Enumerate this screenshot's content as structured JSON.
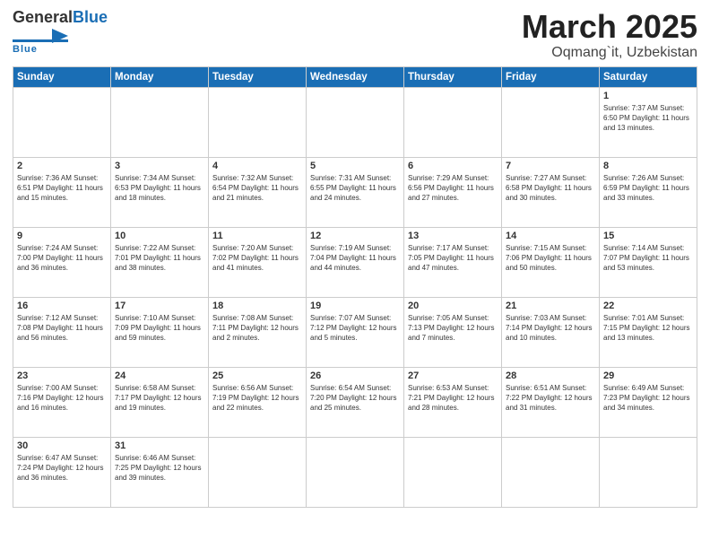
{
  "logo": {
    "general": "General",
    "blue": "Blue",
    "tagline": "Blue"
  },
  "title": "March 2025",
  "subtitle": "Oqmang`it, Uzbekistan",
  "days_of_week": [
    "Sunday",
    "Monday",
    "Tuesday",
    "Wednesday",
    "Thursday",
    "Friday",
    "Saturday"
  ],
  "weeks": [
    [
      {
        "num": "",
        "info": ""
      },
      {
        "num": "",
        "info": ""
      },
      {
        "num": "",
        "info": ""
      },
      {
        "num": "",
        "info": ""
      },
      {
        "num": "",
        "info": ""
      },
      {
        "num": "",
        "info": ""
      },
      {
        "num": "1",
        "info": "Sunrise: 7:37 AM\nSunset: 6:50 PM\nDaylight: 11 hours and 13 minutes."
      }
    ],
    [
      {
        "num": "2",
        "info": "Sunrise: 7:36 AM\nSunset: 6:51 PM\nDaylight: 11 hours and 15 minutes."
      },
      {
        "num": "3",
        "info": "Sunrise: 7:34 AM\nSunset: 6:53 PM\nDaylight: 11 hours and 18 minutes."
      },
      {
        "num": "4",
        "info": "Sunrise: 7:32 AM\nSunset: 6:54 PM\nDaylight: 11 hours and 21 minutes."
      },
      {
        "num": "5",
        "info": "Sunrise: 7:31 AM\nSunset: 6:55 PM\nDaylight: 11 hours and 24 minutes."
      },
      {
        "num": "6",
        "info": "Sunrise: 7:29 AM\nSunset: 6:56 PM\nDaylight: 11 hours and 27 minutes."
      },
      {
        "num": "7",
        "info": "Sunrise: 7:27 AM\nSunset: 6:58 PM\nDaylight: 11 hours and 30 minutes."
      },
      {
        "num": "8",
        "info": "Sunrise: 7:26 AM\nSunset: 6:59 PM\nDaylight: 11 hours and 33 minutes."
      }
    ],
    [
      {
        "num": "9",
        "info": "Sunrise: 7:24 AM\nSunset: 7:00 PM\nDaylight: 11 hours and 36 minutes."
      },
      {
        "num": "10",
        "info": "Sunrise: 7:22 AM\nSunset: 7:01 PM\nDaylight: 11 hours and 38 minutes."
      },
      {
        "num": "11",
        "info": "Sunrise: 7:20 AM\nSunset: 7:02 PM\nDaylight: 11 hours and 41 minutes."
      },
      {
        "num": "12",
        "info": "Sunrise: 7:19 AM\nSunset: 7:04 PM\nDaylight: 11 hours and 44 minutes."
      },
      {
        "num": "13",
        "info": "Sunrise: 7:17 AM\nSunset: 7:05 PM\nDaylight: 11 hours and 47 minutes."
      },
      {
        "num": "14",
        "info": "Sunrise: 7:15 AM\nSunset: 7:06 PM\nDaylight: 11 hours and 50 minutes."
      },
      {
        "num": "15",
        "info": "Sunrise: 7:14 AM\nSunset: 7:07 PM\nDaylight: 11 hours and 53 minutes."
      }
    ],
    [
      {
        "num": "16",
        "info": "Sunrise: 7:12 AM\nSunset: 7:08 PM\nDaylight: 11 hours and 56 minutes."
      },
      {
        "num": "17",
        "info": "Sunrise: 7:10 AM\nSunset: 7:09 PM\nDaylight: 11 hours and 59 minutes."
      },
      {
        "num": "18",
        "info": "Sunrise: 7:08 AM\nSunset: 7:11 PM\nDaylight: 12 hours and 2 minutes."
      },
      {
        "num": "19",
        "info": "Sunrise: 7:07 AM\nSunset: 7:12 PM\nDaylight: 12 hours and 5 minutes."
      },
      {
        "num": "20",
        "info": "Sunrise: 7:05 AM\nSunset: 7:13 PM\nDaylight: 12 hours and 7 minutes."
      },
      {
        "num": "21",
        "info": "Sunrise: 7:03 AM\nSunset: 7:14 PM\nDaylight: 12 hours and 10 minutes."
      },
      {
        "num": "22",
        "info": "Sunrise: 7:01 AM\nSunset: 7:15 PM\nDaylight: 12 hours and 13 minutes."
      }
    ],
    [
      {
        "num": "23",
        "info": "Sunrise: 7:00 AM\nSunset: 7:16 PM\nDaylight: 12 hours and 16 minutes."
      },
      {
        "num": "24",
        "info": "Sunrise: 6:58 AM\nSunset: 7:17 PM\nDaylight: 12 hours and 19 minutes."
      },
      {
        "num": "25",
        "info": "Sunrise: 6:56 AM\nSunset: 7:19 PM\nDaylight: 12 hours and 22 minutes."
      },
      {
        "num": "26",
        "info": "Sunrise: 6:54 AM\nSunset: 7:20 PM\nDaylight: 12 hours and 25 minutes."
      },
      {
        "num": "27",
        "info": "Sunrise: 6:53 AM\nSunset: 7:21 PM\nDaylight: 12 hours and 28 minutes."
      },
      {
        "num": "28",
        "info": "Sunrise: 6:51 AM\nSunset: 7:22 PM\nDaylight: 12 hours and 31 minutes."
      },
      {
        "num": "29",
        "info": "Sunrise: 6:49 AM\nSunset: 7:23 PM\nDaylight: 12 hours and 34 minutes."
      }
    ],
    [
      {
        "num": "30",
        "info": "Sunrise: 6:47 AM\nSunset: 7:24 PM\nDaylight: 12 hours and 36 minutes."
      },
      {
        "num": "31",
        "info": "Sunrise: 6:46 AM\nSunset: 7:25 PM\nDaylight: 12 hours and 39 minutes."
      },
      {
        "num": "",
        "info": ""
      },
      {
        "num": "",
        "info": ""
      },
      {
        "num": "",
        "info": ""
      },
      {
        "num": "",
        "info": ""
      },
      {
        "num": "",
        "info": ""
      }
    ]
  ]
}
